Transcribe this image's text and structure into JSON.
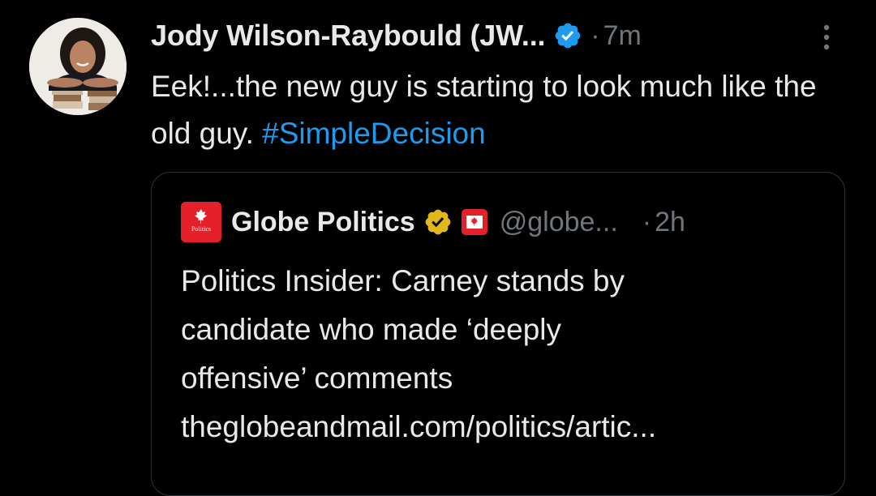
{
  "tweet": {
    "author": {
      "display_name": "Jody Wilson-Raybould (JW...",
      "verified_icon": "blue-check-icon",
      "avatar_icon": "profile-photo"
    },
    "separator": "·",
    "timestamp": "7m",
    "more_icon": "more-vertical-icon",
    "text": "Eek!...the new guy is starting to look much like the old guy. ",
    "hashtag": "#SimpleDecision"
  },
  "quote": {
    "avatar_label": "Politics",
    "name": "Globe Politics",
    "gold_badge_icon": "gold-check-icon",
    "flag_icon": "canada-flag-icon",
    "handle": "@globe...",
    "separator": "·",
    "timestamp": "2h",
    "text_line1": "Politics Insider: Carney stands by",
    "text_line2": "candidate who made ‘deeply",
    "text_line3": "offensive’ comments",
    "text_line4": "theglobeandmail.com/politics/artic..."
  },
  "colors": {
    "background": "#000000",
    "text": "#e7e9ea",
    "muted": "#71767b",
    "link": "#1d9bf0",
    "verified_blue": "#1d9bf0",
    "verified_gold": "#e2b719",
    "globe_red": "#e4202a",
    "border": "#2f3336"
  }
}
